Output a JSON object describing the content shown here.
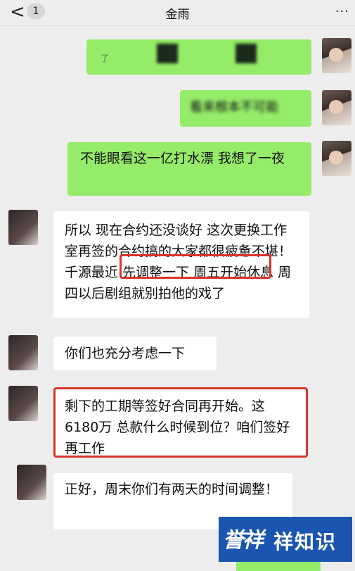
{
  "header": {
    "back_icon": "chevron-left-icon",
    "back_glyph": "<",
    "unread_count": "1",
    "title": "金雨",
    "more_glyph": "···"
  },
  "messages": [
    {
      "side": "right",
      "text": "",
      "note_chars": "了"
    },
    {
      "side": "right",
      "text": "看来根本不可能"
    },
    {
      "side": "right",
      "text": "不能眼看这一亿打水漂 我想了一夜"
    },
    {
      "side": "left",
      "text": "所以 现在合约还没谈好 这次更换工作室再签的合约搞的大家都很疲惫不堪！千源最近 先调整一下 周五开始休息 周四以后剧组就别拍他的戏了"
    },
    {
      "side": "left",
      "text": "你们也充分考虑一下"
    },
    {
      "side": "left",
      "text": "剩下的工期等签好合同再开始。这6180万 总款什么时候到位？咱们签好再工作"
    },
    {
      "side": "left",
      "text": "正好，周末你们有两天的时间调整！"
    }
  ],
  "watermark": {
    "logo": "誉祥",
    "text": "祥知识"
  },
  "colors": {
    "green_bubble": "#95ec69",
    "white_bubble": "#ffffff",
    "highlight": "#d9342b",
    "background": "#ededed"
  }
}
